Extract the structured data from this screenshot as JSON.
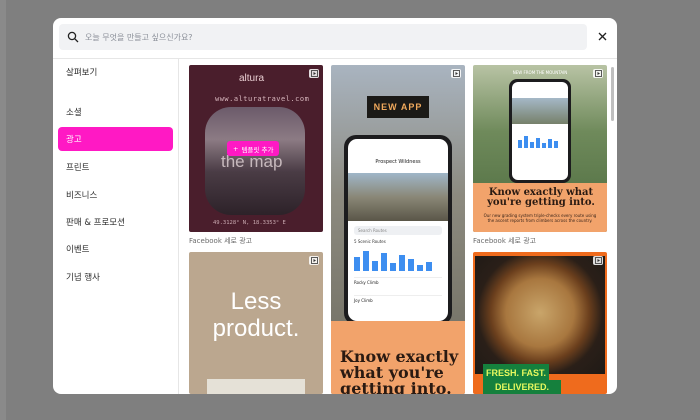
{
  "search": {
    "placeholder": "오늘 무엇을 만들고 싶으신가요?"
  },
  "sidebar": {
    "items": [
      {
        "label": "살펴보기"
      },
      {
        "label": "소셜"
      },
      {
        "label": "광고"
      },
      {
        "label": "프린트"
      },
      {
        "label": "비즈니스"
      },
      {
        "label": "판매 & 프로모션"
      },
      {
        "label": "이벤트"
      },
      {
        "label": "기념 행사"
      }
    ],
    "active_index": 2
  },
  "cards": {
    "altura": {
      "logo": "altura",
      "url": "www.alturatravel.com",
      "headline": "the map",
      "coords": "49.3128° N, 18.3353° E",
      "use_button": "템플릿 추가",
      "caption": "Facebook 세로 광고"
    },
    "new_app": {
      "badge_text": "NEW APP",
      "screen_title": "Prospect Wildness",
      "search_hint": "Search Routes",
      "routes_label": "5 Scenic Routes",
      "row1": "Rocky Climb",
      "row2": "Joy Climb",
      "headline": "Know exactly what you're getting into."
    },
    "mountain": {
      "top_text": "NEW FROM THE MOUNTAIN",
      "headline": "Know exactly what you're getting into.",
      "sub": "Our new grading system triple-checks every route using the ascent reports from climbers across the country.",
      "caption": "Facebook 세로 광고"
    },
    "less": {
      "headline": "Less product."
    },
    "pizza": {
      "line1": "FRESH. FAST.",
      "line2": "DELIVERED."
    }
  },
  "colors": {
    "accent": "#ff19c4",
    "orange": "#f2a36b"
  }
}
